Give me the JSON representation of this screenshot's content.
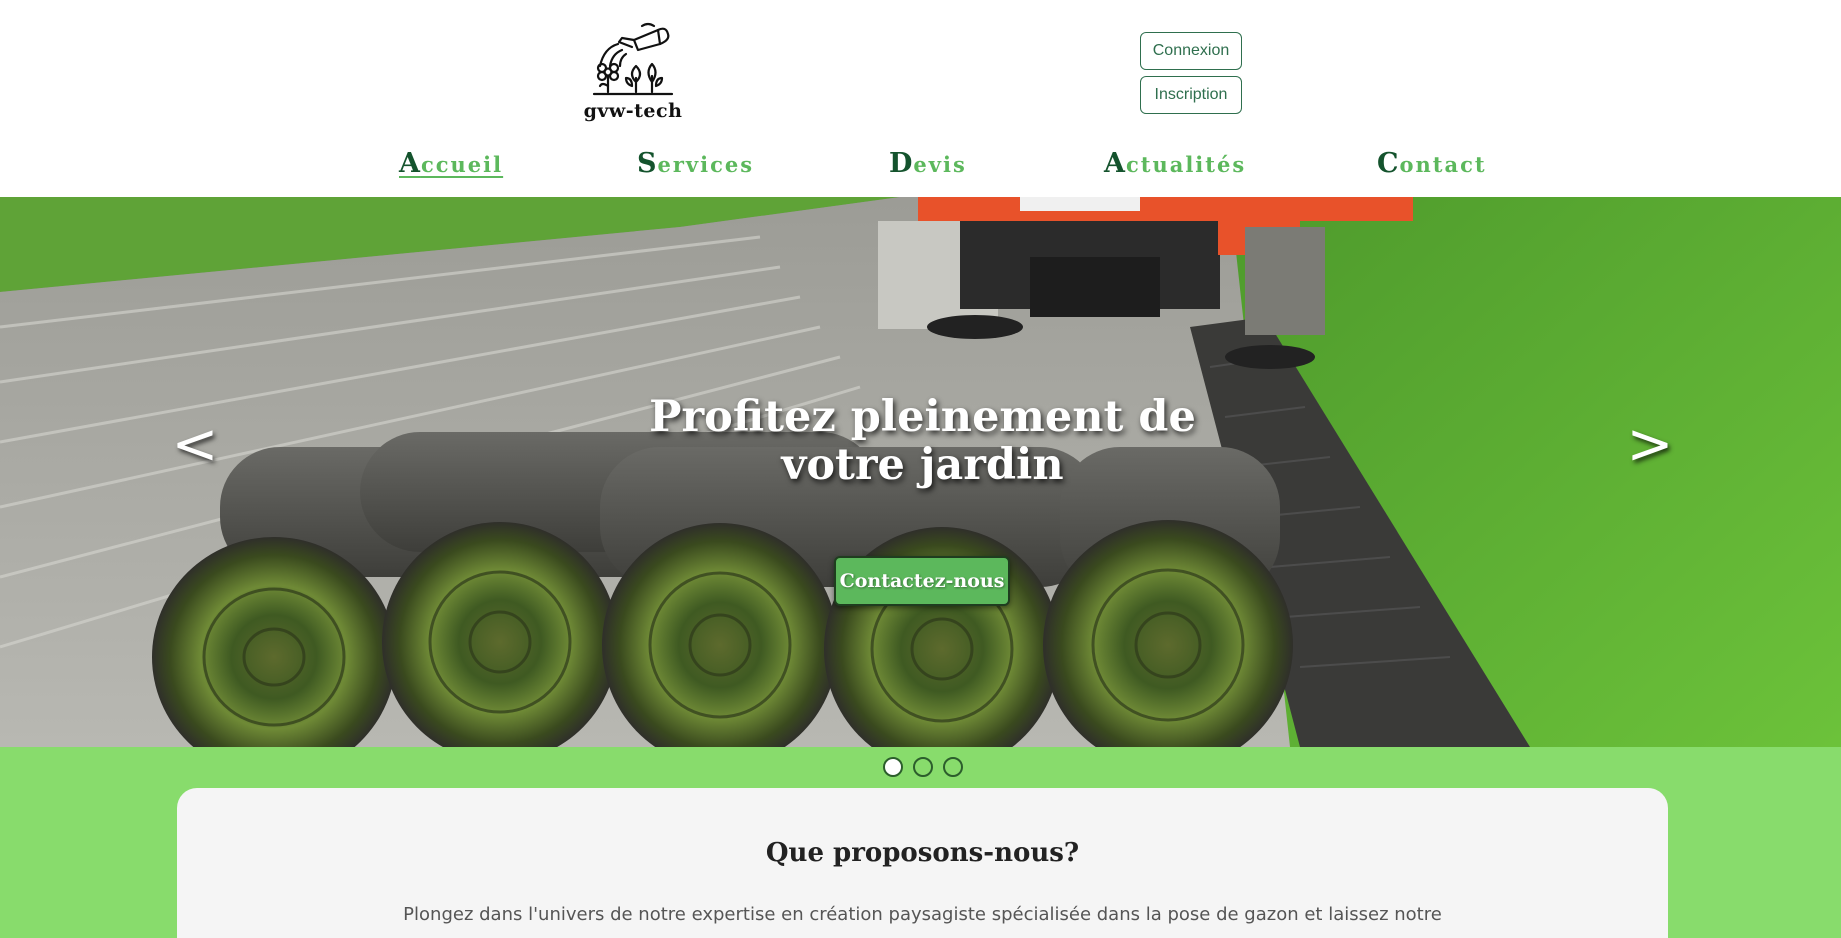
{
  "brand": {
    "name": "gvw-tech",
    "logo_icon": "watering-can-plants-icon"
  },
  "auth": {
    "login_label": "Connexion",
    "signup_label": "Inscription",
    "accent": "#2f6f4e"
  },
  "nav": {
    "items": [
      {
        "first": "A",
        "rest": "ccueil",
        "active": true
      },
      {
        "first": "S",
        "rest": "ervices",
        "active": false
      },
      {
        "first": "D",
        "rest": "evis",
        "active": false
      },
      {
        "first": "A",
        "rest": "ctualités",
        "active": false
      },
      {
        "first": "C",
        "rest": "ontact",
        "active": false
      }
    ],
    "colors": {
      "initial": "#14532d",
      "text": "#5cb85c"
    }
  },
  "hero": {
    "title_line1": "Profitez pleinement de",
    "title_line2": "votre jardin",
    "cta_label": "Contactez-nous",
    "prev_label": "<",
    "next_label": ">",
    "slide_count": 3,
    "active_slide": 1
  },
  "section": {
    "title": "Que proposons-nous?",
    "text": "Plongez dans l'univers de notre expertise en création paysagiste spécialisée dans la pose de gazon et laissez notre"
  },
  "colors": {
    "band": "#88dc6c",
    "card": "#f5f5f5",
    "cta": "#5cb85c"
  }
}
